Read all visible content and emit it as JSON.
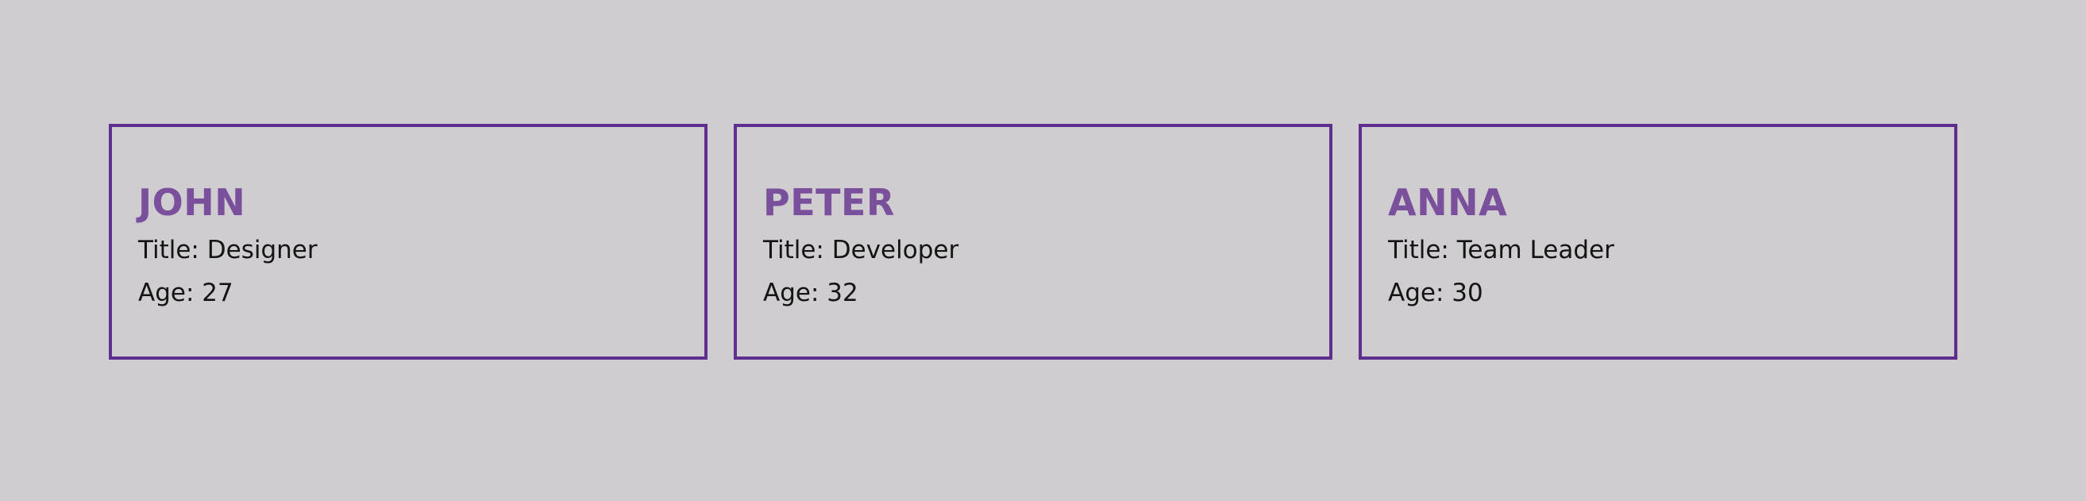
{
  "colors": {
    "background": "#d0cdd0",
    "card_border": "#5f2f90",
    "name_text": "#7a4f9b",
    "body_text": "#141414"
  },
  "cards": [
    {
      "name": "JOHN",
      "title_label": "Title:",
      "title": "Designer",
      "age_label": "Age:",
      "age": "27"
    },
    {
      "name": "PETER",
      "title_label": "Title:",
      "title": "Developer",
      "age_label": "Age:",
      "age": "32"
    },
    {
      "name": "ANNA",
      "title_label": "Title:",
      "title": "Team Leader",
      "age_label": "Age:",
      "age": "30"
    }
  ]
}
